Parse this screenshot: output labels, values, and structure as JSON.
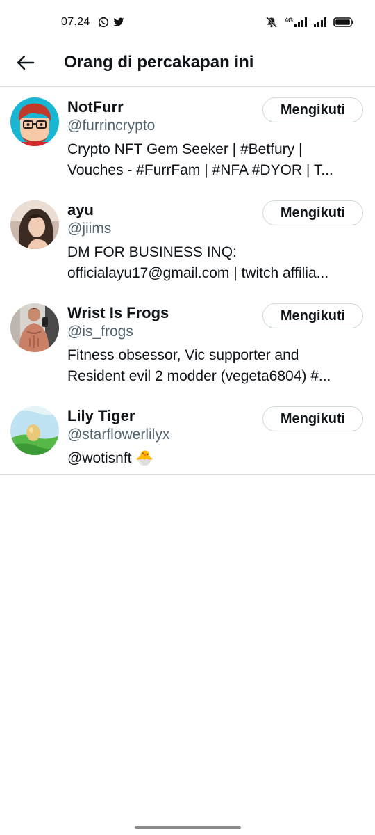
{
  "status_bar": {
    "time": "07.24",
    "network_label": "4G",
    "left_icons": [
      "whatsapp-icon",
      "twitter-icon"
    ],
    "right_icons": [
      "mute-bell-icon",
      "signal-icon",
      "signal-icon",
      "battery-icon"
    ]
  },
  "header": {
    "back_icon": "arrow-left-icon",
    "title": "Orang di percakapan ini"
  },
  "users": [
    {
      "name": "NotFurr",
      "handle": "@furrincrypto",
      "bio_lines": [
        "Crypto NFT Gem Seeker | #Betfury |",
        "Vouches - #FurrFam | #NFA #DYOR | T..."
      ],
      "button": "Mengikuti"
    },
    {
      "name": "ayu",
      "handle": "@jiims",
      "bio_lines": [
        "DM FOR BUSINESS INQ:",
        "officialayu17@gmail.com |  twitch affilia..."
      ],
      "button": "Mengikuti"
    },
    {
      "name": "Wrist Is Frogs",
      "handle": "@is_frogs",
      "bio_lines": [
        "Fitness obsessor, Vic supporter and",
        "Resident evil 2 modder (vegeta6804) #..."
      ],
      "button": "Mengikuti"
    },
    {
      "name": "Lily Tiger",
      "handle": "@starflowerlilyx",
      "bio_lines": [
        "@wotisnft 🐣"
      ],
      "button": "Mengikuti"
    }
  ],
  "colors": {
    "text_primary": "#0f1419",
    "text_secondary": "#536471",
    "divider": "#d9e1e5",
    "button_border": "#cfd9de"
  }
}
